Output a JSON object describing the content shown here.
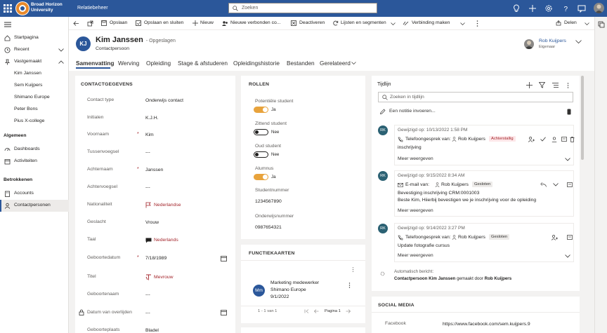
{
  "app": {
    "org_line1": "Broad Horizon",
    "org_line2": "University",
    "title": "Relatiebeheer",
    "search_placeholder": "Zoeken"
  },
  "sidebar": {
    "pinned_items": [
      {
        "label": "Startpagina",
        "icon": "home-icon"
      },
      {
        "label": "Recent",
        "icon": "clock-icon"
      },
      {
        "label": "Vastgemaakt",
        "icon": "pin-icon"
      }
    ],
    "pinned_records": [
      "Kim Janssen",
      "Sem Kuijpers",
      "Shimano Europe",
      "Peter Bons",
      "Pius X-college"
    ],
    "section_general": "Algemeen",
    "general_items": [
      {
        "label": "Dashboards",
        "icon": "dashboard-icon"
      },
      {
        "label": "Activiteiten",
        "icon": "activity-icon"
      }
    ],
    "section_relations": "Betrokkenen",
    "relation_items": [
      {
        "label": "Accounts",
        "icon": "accounts-icon"
      },
      {
        "label": "Contactpersonen",
        "icon": "contact-icon"
      }
    ]
  },
  "commands": {
    "save": "Opslaan",
    "save_close": "Opslaan en sluiten",
    "new": "Nieuw",
    "new_connections": "Nieuwe verbonden co...",
    "deactivate": "Deactiveren",
    "lists_segments": "Lijsten en segmenten",
    "connect": "Verbinding maken",
    "share": "Delen"
  },
  "record": {
    "initials": "KJ",
    "name": "Kim Janssen",
    "status": "- Opgeslagen",
    "entity": "Contactpersoon",
    "owner_name": "Rob Kuijpers",
    "owner_role": "Eigenaar"
  },
  "tabs": [
    "Samenvatting",
    "Werving",
    "Opleiding",
    "Stage & afstuderen",
    "Opleidingshistorie",
    "Bestanden",
    "Gerelateerd"
  ],
  "contact": {
    "section_title": "CONTACTGEGEVENS",
    "fields": [
      {
        "label": "Contact type",
        "value": "Onderwijs contact",
        "required": false
      },
      {
        "label": "Initialen",
        "value": "K.J.H.",
        "required": false
      },
      {
        "label": "Voornaam",
        "value": "Kim",
        "required": true
      },
      {
        "label": "Tussenvoegsel",
        "value": "---",
        "required": false
      },
      {
        "label": "Achternaam",
        "value": "Janssen",
        "required": true
      },
      {
        "label": "Achtervoegsel",
        "value": "---",
        "required": false
      },
      {
        "label": "Nationaliteit",
        "value": "Nederlandse",
        "required": false
      },
      {
        "label": "Geslacht",
        "value": "Vrouw",
        "required": false
      },
      {
        "label": "Taal",
        "value": "Nederlands",
        "required": false
      },
      {
        "label": "Geboortedatum",
        "value": "7/18/1989",
        "required": true
      },
      {
        "label": "Titel",
        "value": "Mevrouw",
        "required": false
      },
      {
        "label": "Geboortenaam",
        "value": "---",
        "required": false
      },
      {
        "label": "Datum van overlijden",
        "value": "---",
        "required": false
      },
      {
        "label": "Geboorteplaats",
        "value": "Bladel",
        "required": false
      }
    ]
  },
  "roles": {
    "section_title": "ROLLEN",
    "items": [
      {
        "label": "Potentiële student",
        "state": "Ja",
        "on": true
      },
      {
        "label": "Zittend student",
        "state": "Nee",
        "on": false
      },
      {
        "label": "Oud student",
        "state": "Nee",
        "on": false
      },
      {
        "label": "Alumnus",
        "state": "Ja",
        "on": true
      }
    ],
    "student_number_label": "Studentnummer",
    "student_number": "1234567890",
    "education_number_label": "Onderwijsnummer",
    "education_number": "0987654321"
  },
  "functions": {
    "section_title": "FUNCTIEKAARTEN",
    "card": {
      "initials": "Mm",
      "line1": "Marketing medewerker",
      "line2": "Shimano Europe",
      "line3": "9/1/2022"
    },
    "pager_range": "1 - 1 van 1",
    "pager_page": "Pagina 1"
  },
  "timeline": {
    "title": "Tijdlijn",
    "search_placeholder": "Zoeken in tijdlijn",
    "note_placeholder": "Een notitie invoeren...",
    "entries": [
      {
        "avatar": "RK",
        "modified": "Gewijzigd op: 10/13/2022 1:58 PM",
        "type": "Telefoongesprek van:",
        "person": "Rob Kuijpers",
        "badge": "Achterstallig",
        "badge_color": "#fde7e9",
        "badge_text_color": "#a4262c",
        "line1": "inschrijving",
        "line2": "",
        "more": "Meer weergeven"
      },
      {
        "avatar": "RK",
        "modified": "Gewijzigd op: 9/15/2022 8:34 AM",
        "type": "E-mail van:",
        "person": "Rob Kuijpers",
        "badge": "Gesloten",
        "badge_color": "#edebe9",
        "badge_text_color": "#323130",
        "line1": "Bevestiging inschrijving CRM:0001003",
        "line2": "Beste Kim,   Hiierbij bevestigen we je inschrijving voor de opleiding",
        "more": "Meer weergeven"
      },
      {
        "avatar": "RK",
        "modified": "Gewijzigd op: 9/14/2022 3:27 PM",
        "type": "Telefoongesprek van:",
        "person": "Rob Kuijpers",
        "badge": "Gesloten",
        "badge_color": "#edebe9",
        "badge_text_color": "#323130",
        "line1": "Update fotografie cursus",
        "line2": "",
        "more": "Meer weergeven"
      }
    ],
    "auto_post_label": "Automatisch bericht:",
    "auto_post_subject": "Contactpersoon Kim Janssen",
    "auto_post_middle": "gemaakt door",
    "auto_post_author": "Rob Kuijpers"
  },
  "social": {
    "section_title": "SOCIAL MEDIA",
    "facebook_label": "Facebook",
    "facebook_url": "https://www.facebook.com/sem.kuijpers.9"
  },
  "colors": {
    "header_blue": "#2b579a",
    "toggle_on": "#e8a33c",
    "required_red": "#a4262c",
    "link_blue": "#115ea3"
  }
}
